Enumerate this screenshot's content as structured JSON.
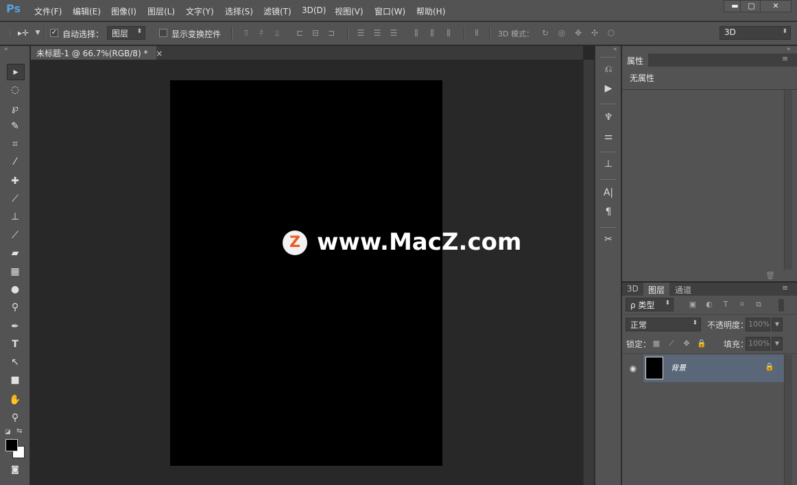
{
  "app": {
    "logo": "Ps"
  },
  "menu": [
    "文件(F)",
    "编辑(E)",
    "图像(I)",
    "图层(L)",
    "文字(Y)",
    "选择(S)",
    "滤镜(T)",
    "3D(D)",
    "视图(V)",
    "窗口(W)",
    "帮助(H)"
  ],
  "window_controls": {
    "minimize": "▬",
    "maximize": "▢",
    "close": "✕"
  },
  "options": {
    "auto_select_label": "自动选择：",
    "auto_select_checked": true,
    "auto_select_value": "图层",
    "show_transform_label": "显示变换控件",
    "mode_3d_label": "3D 模式：",
    "workspace_value": "3D"
  },
  "document": {
    "tab_title": "未标题-1 @ 66.7%(RGB/8) *",
    "tab_close": "×",
    "canvas_color": "#000000"
  },
  "watermark": {
    "badge": "Z",
    "text": "www.MacZ.com"
  },
  "properties_panel": {
    "tab": "属性",
    "content": "无属性"
  },
  "layers_panel": {
    "tabs": [
      "3D",
      "图层",
      "通道"
    ],
    "active_tab": "图层",
    "filter_label": "ρ 类型",
    "blend_mode": "正常",
    "opacity_label": "不透明度：",
    "opacity_value": "100%",
    "lock_label": "锁定：",
    "fill_label": "填充：",
    "fill_value": "100%",
    "layers": [
      {
        "name": "背景",
        "visible": true,
        "locked": true,
        "thumbnail_color": "#000000"
      }
    ]
  },
  "colors": {
    "foreground": "#000000",
    "background": "#ffffff",
    "accent": "#5aa0e0",
    "watermark_badge": "#f05a22"
  }
}
